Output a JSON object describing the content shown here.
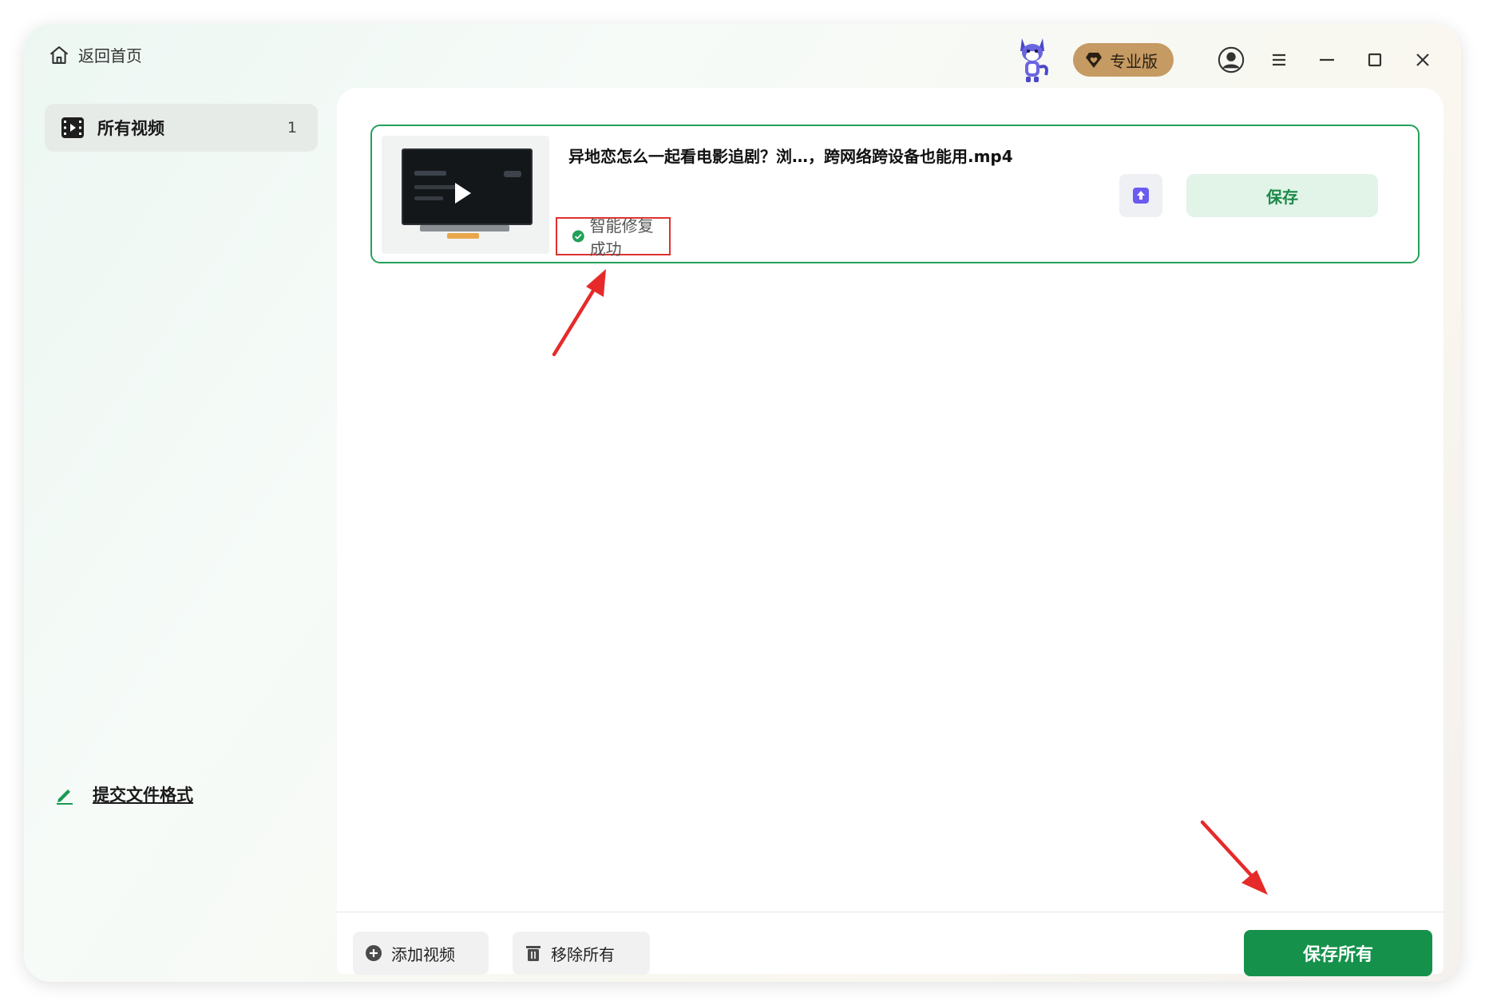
{
  "nav": {
    "back_label": "返回首页"
  },
  "topbar": {
    "pro_label": "专业版",
    "icons": [
      "mascot-icon",
      "diamond-heart-icon",
      "user-avatar-icon",
      "menu-icon",
      "minimize-icon",
      "maximize-icon",
      "close-icon"
    ]
  },
  "sidebar": {
    "items": [
      {
        "label": "所有视频",
        "count": "1",
        "icon": "video-icon"
      }
    ],
    "submit_format_label": "提交文件格式"
  },
  "files": [
    {
      "name": "异地恋怎么一起看电影追剧？浏…，跨网络跨设备也能用.mp4",
      "status": "智能修复成功",
      "save_label": "保存"
    }
  ],
  "footer": {
    "add_label": "添加视频",
    "remove_label": "移除所有",
    "save_all_label": "保存所有"
  },
  "colors": {
    "accent": "#15914b",
    "card_border": "#24a05a",
    "pro_badge": "#c59a63",
    "annotation": "#e03030",
    "upload_icon": "#6a5cf0"
  }
}
